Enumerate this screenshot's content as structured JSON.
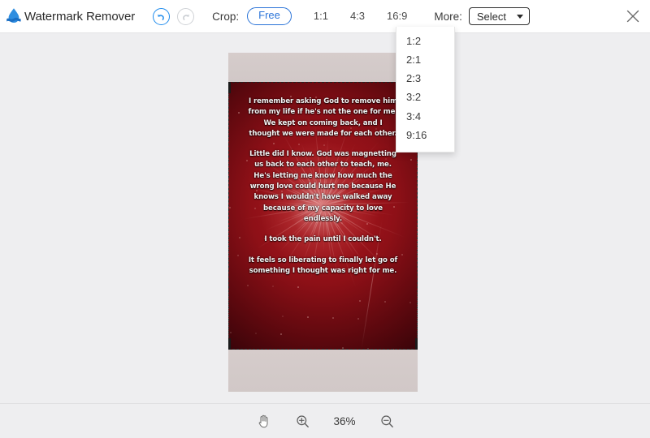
{
  "app": {
    "brand_name": "Watermark Remover",
    "logo_icon": "water-drop-logo"
  },
  "header": {
    "undo_icon": "undo-arrow-icon",
    "redo_icon": "redo-arrow-icon",
    "crop_label": "Crop:",
    "ratios": [
      {
        "label": "Free",
        "selected": true
      },
      {
        "label": "1:1",
        "selected": false
      },
      {
        "label": "4:3",
        "selected": false
      },
      {
        "label": "16:9",
        "selected": false
      }
    ],
    "more_label": "More:",
    "select_value": "Select",
    "caret_icon": "chevron-down-icon",
    "close_icon": "close-icon",
    "accent_color": "#2b74d8",
    "active_color": "#1f8ced"
  },
  "dropdown": {
    "open": true,
    "items": [
      "1:2",
      "2:1",
      "2:3",
      "3:2",
      "3:4",
      "9:16"
    ]
  },
  "canvas": {
    "image_alt": "fireworks-photo-with-text",
    "paragraphs": [
      "I remember asking God to remove him from my life if he's not the one for me. We kept on coming back, and I thought we were made for each other.",
      "Little did I know. God was magnetting us back to each other to teach, me. He's letting me know how much the wrong love could hurt me because He knows I wouldn't have walked away because of my capacity to love endlessly.",
      "I took the pain until I couldn't.",
      "It feels so liberating to finally let go of something I thought was right for me."
    ],
    "crop_selection": true
  },
  "bottombar": {
    "pan_icon": "hand-pan-icon",
    "zoom_in_icon": "zoom-in-icon",
    "zoom_out_icon": "zoom-out-icon",
    "zoom_level": "36%"
  }
}
